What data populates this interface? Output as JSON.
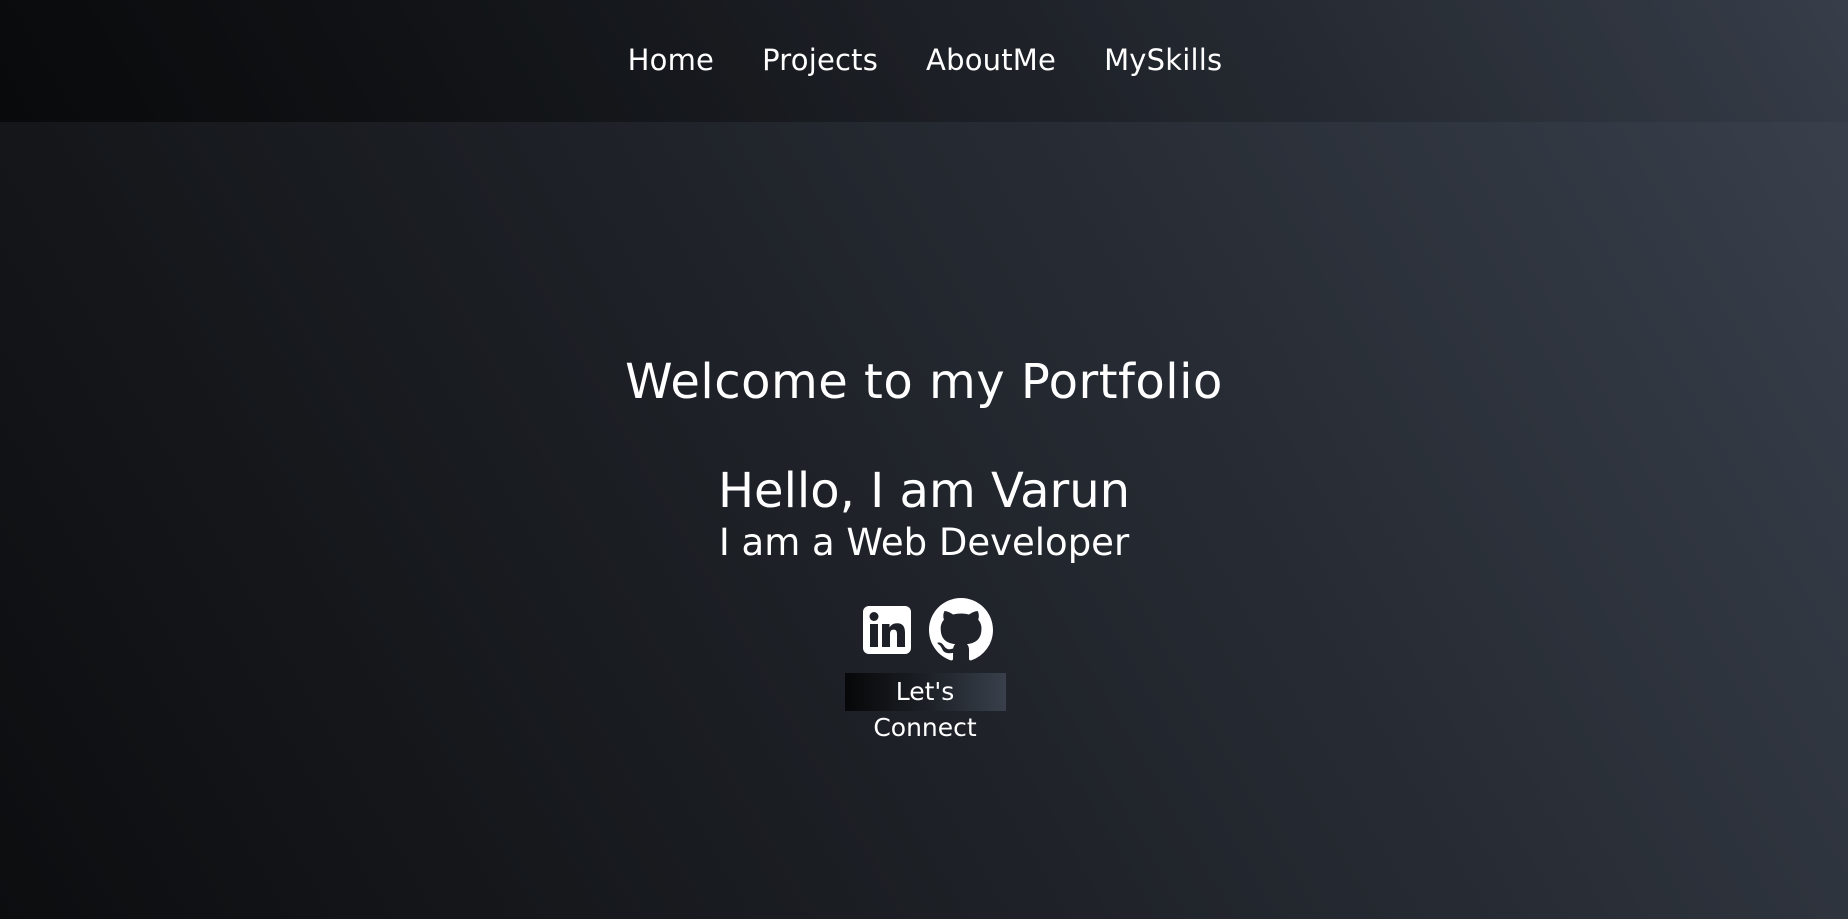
{
  "nav": {
    "items": [
      {
        "label": "Home"
      },
      {
        "label": "Projects"
      },
      {
        "label": "AboutMe"
      },
      {
        "label": "MySkills"
      }
    ]
  },
  "hero": {
    "welcome": "Welcome to my Portfolio",
    "greeting": "Hello, I am Varun",
    "role": "I am a Web Developer"
  },
  "socials": {
    "icons": [
      "linkedin-icon",
      "github-icon"
    ]
  },
  "cta": {
    "connect_label": "Let's Connect"
  },
  "colors": {
    "text": "#ffffff",
    "bg_dark": "#0c0d0f",
    "bg_light": "#3a414d"
  }
}
